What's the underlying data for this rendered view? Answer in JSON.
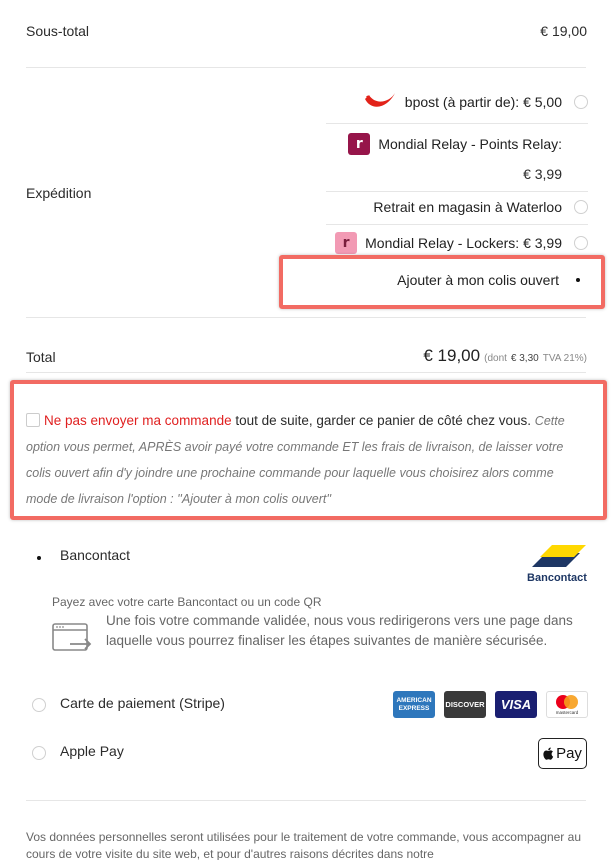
{
  "summary": {
    "subtotal_label": "Sous-total",
    "subtotal_value": "€ 19,00",
    "shipping_label": "Expédition",
    "total_label": "Total",
    "total_value": "€ 19,00",
    "total_tax_prefix": "(dont",
    "total_tax_amount": "€ 3,30",
    "total_tax_suffix": "TVA 21%)"
  },
  "shipping_options": [
    {
      "label": "bpost (à partir de): € 5,00",
      "logo": "bpost-logo",
      "selected": false
    },
    {
      "label_line1": "Mondial Relay - Points Relay:",
      "label_line2": "€ 3,99",
      "logo": "mondial-relay-logo",
      "logo_color": "#96154a",
      "selected": false
    },
    {
      "label": "Retrait en magasin à Waterloo",
      "selected": false
    },
    {
      "label": "Mondial Relay - Lockers: € 3,99",
      "logo": "mondial-relay-lockers-logo",
      "logo_color": "#f29ab4",
      "selected": false
    },
    {
      "label": "Ajouter à mon colis ouvert",
      "selected": true
    }
  ],
  "hold_order": {
    "highlight": "Ne pas envoyer ma commande",
    "main": " tout de suite, garder ce panier de côté chez vous.",
    "note": "Cette option vous permet, APRÈS avoir payé votre commande ET les frais de livraison, de laisser votre colis ouvert afin d'y joindre une prochaine commande pour laquelle vous choisirez alors comme mode de livraison l'option : ''Ajouter à mon colis ouvert''"
  },
  "payment": {
    "bancontact_label": "Bancontact",
    "bancontact_logo_text": "Bancontact",
    "bancontact_desc": "Payez avec votre carte Bancontact ou un code QR",
    "redirect_text": "Une fois votre commande validée, nous vous redirigerons vers une page dans laquelle vous pourrez finaliser les étapes suivantes de manière sécurisée.",
    "stripe_label": "Carte de paiement (Stripe)",
    "amex_text_1": "AMERICAN",
    "amex_text_2": "EXPRESS",
    "discover_text": "DISCOVER",
    "visa_text": "VISA",
    "mastercard_text": "mastercard",
    "applepay_label": "Apple Pay",
    "applepay_badge": "Pay"
  },
  "privacy": {
    "text": "Vos données personnelles seront utilisées pour le traitement de votre commande, vous accompagner au cours de votre visite du site web, et pour d'autres raisons décrites dans notre"
  },
  "colors": {
    "accent_red": "#f26b63",
    "highlight_red": "#e02020",
    "bpost_red": "#e2231a",
    "bancontact_blue": "#1e3764",
    "bancontact_yellow": "#ffd800"
  }
}
